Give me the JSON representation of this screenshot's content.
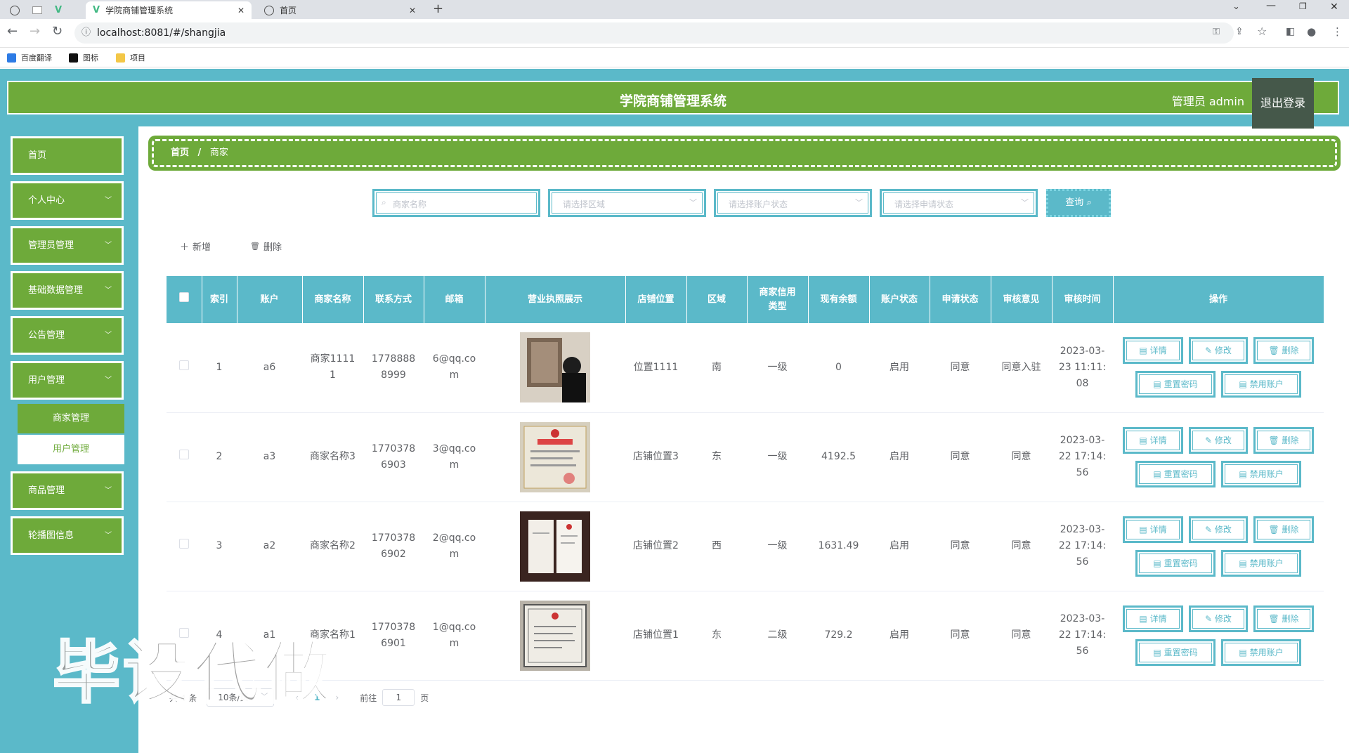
{
  "browser": {
    "tabs": [
      {
        "title": "学院商铺管理系统",
        "active": true
      },
      {
        "title": "首页",
        "active": false
      }
    ],
    "url": "localhost:8081/#/shangjia",
    "bookmarks": [
      "百度翻译",
      "图标",
      "项目"
    ]
  },
  "header": {
    "title": "学院商铺管理系统",
    "user": "管理员 admin",
    "logout": "退出登录"
  },
  "sidebar": {
    "items": [
      {
        "label": "首页",
        "has_children": false
      },
      {
        "label": "个人中心",
        "has_children": true
      },
      {
        "label": "管理员管理",
        "has_children": true
      },
      {
        "label": "基础数据管理",
        "has_children": true
      },
      {
        "label": "公告管理",
        "has_children": true
      },
      {
        "label": "用户管理",
        "has_children": true,
        "expanded": true
      },
      {
        "label": "商品管理",
        "has_children": true
      },
      {
        "label": "轮播图信息",
        "has_children": true
      }
    ],
    "submenu": [
      {
        "label": "商家管理",
        "active": true
      },
      {
        "label": "用户管理",
        "active": false
      }
    ]
  },
  "breadcrumb": {
    "home": "首页",
    "sep": "/",
    "current": "商家"
  },
  "search": {
    "name_placeholder": "商家名称",
    "area_placeholder": "请选择区域",
    "account_placeholder": "请选择账户状态",
    "apply_placeholder": "请选择申请状态",
    "query_label": "查询"
  },
  "actions": {
    "add": "新增",
    "delete": "删除"
  },
  "table": {
    "headers": [
      "索引",
      "账户",
      "商家名称",
      "联系方式",
      "邮箱",
      "营业执照展示",
      "店铺位置",
      "区域",
      "商家信用类型",
      "现有余额",
      "账户状态",
      "申请状态",
      "审核意见",
      "审核时间",
      "操作"
    ],
    "rows": [
      {
        "index": "1",
        "account": "a6",
        "name": "商家11111",
        "phone": "17788888999",
        "email": "6@qq.com",
        "location": "位置1111",
        "area": "南",
        "credit": "一级",
        "balance": "0",
        "acct_status": "启用",
        "apply_status": "同意",
        "opinion": "同意入驻",
        "time": "2023-03-23 11:11:08"
      },
      {
        "index": "2",
        "account": "a3",
        "name": "商家名称3",
        "phone": "17703786903",
        "email": "3@qq.com",
        "location": "店铺位置3",
        "area": "东",
        "credit": "一级",
        "balance": "4192.5",
        "acct_status": "启用",
        "apply_status": "同意",
        "opinion": "同意",
        "time": "2023-03-22 17:14:56"
      },
      {
        "index": "3",
        "account": "a2",
        "name": "商家名称2",
        "phone": "17703786902",
        "email": "2@qq.com",
        "location": "店铺位置2",
        "area": "西",
        "credit": "一级",
        "balance": "1631.49",
        "acct_status": "启用",
        "apply_status": "同意",
        "opinion": "同意",
        "time": "2023-03-22 17:14:56"
      },
      {
        "index": "4",
        "account": "a1",
        "name": "商家名称1",
        "phone": "17703786901",
        "email": "1@qq.com",
        "location": "店铺位置1",
        "area": "东",
        "credit": "二级",
        "balance": "729.2",
        "acct_status": "启用",
        "apply_status": "同意",
        "opinion": "同意",
        "time": "2023-03-22 17:14:56"
      }
    ],
    "op_labels": {
      "detail": "详情",
      "edit": "修改",
      "delete": "删除",
      "reset": "重置密码",
      "disable": "禁用账户"
    }
  },
  "pagination": {
    "total": "共 4 条",
    "page_size": "10条/页",
    "current": "1",
    "goto": "前往",
    "goto_value": "1",
    "page_unit": "页"
  },
  "watermark": "毕设代做",
  "colors": {
    "primary": "#6eaa3a",
    "accent": "#5bb9c9"
  }
}
